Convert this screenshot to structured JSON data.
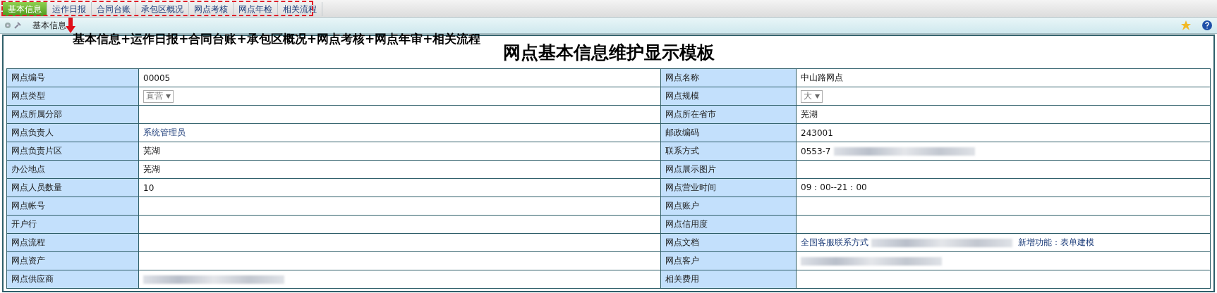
{
  "tabs": [
    {
      "label": "基本信息",
      "selected": true
    },
    {
      "label": "运作日报",
      "selected": false
    },
    {
      "label": "合同台账",
      "selected": false
    },
    {
      "label": "承包区概况",
      "selected": false
    },
    {
      "label": "网点考核",
      "selected": false
    },
    {
      "label": "网点年检",
      "selected": false
    },
    {
      "label": "相关流程",
      "selected": false
    }
  ],
  "breadcrumb": "基本信息",
  "annotation": "基本信息+运作日报+合同台账+承包区概况+网点考核+网点年审+相关流程",
  "title": "网点基本信息维护显示模板",
  "rows": [
    {
      "left": {
        "label": "网点编号",
        "value": [
          {
            "kind": "text",
            "text": "00005"
          }
        ]
      },
      "right": {
        "label": "网点名称",
        "value": [
          {
            "kind": "text",
            "text": "中山路网点"
          }
        ]
      }
    },
    {
      "left": {
        "label": "网点类型",
        "value": [
          {
            "kind": "select",
            "text": "直营"
          }
        ]
      },
      "right": {
        "label": "网点规模",
        "value": [
          {
            "kind": "select",
            "text": "大"
          }
        ]
      }
    },
    {
      "left": {
        "label": "网点所属分部"
      },
      "right": {
        "label": "网点所在省市",
        "value": [
          {
            "kind": "text",
            "text": "芜湖"
          }
        ]
      }
    },
    {
      "left": {
        "label": "网点负责人",
        "value": [
          {
            "kind": "link",
            "text": "系统管理员"
          }
        ]
      },
      "right": {
        "label": "邮政编码",
        "value": [
          {
            "kind": "text",
            "text": "243001"
          }
        ]
      }
    },
    {
      "left": {
        "label": "网点负责片区",
        "value": [
          {
            "kind": "text",
            "text": "芜湖"
          }
        ]
      },
      "right": {
        "label": "联系方式",
        "value": [
          {
            "kind": "text",
            "text": "0553-7"
          },
          {
            "kind": "redacted"
          }
        ]
      }
    },
    {
      "left": {
        "label": "办公地点",
        "value": [
          {
            "kind": "text",
            "text": "芜湖"
          }
        ]
      },
      "right": {
        "label": "网点展示图片"
      }
    },
    {
      "left": {
        "label": "网点人员数量",
        "value": [
          {
            "kind": "text",
            "text": "10"
          }
        ]
      },
      "right": {
        "label": "网点营业时间",
        "value": [
          {
            "kind": "text",
            "text": "09：00--21：00"
          }
        ]
      }
    },
    {
      "left": {
        "label": "网点帐号"
      },
      "right": {
        "label": "网点账户"
      }
    },
    {
      "left": {
        "label": "开户行"
      },
      "right": {
        "label": "网点信用度"
      }
    },
    {
      "left": {
        "label": "网点流程"
      },
      "right": {
        "label": "网点文档",
        "value": [
          {
            "kind": "link",
            "text": "全国客服联系方式"
          },
          {
            "kind": "redacted"
          },
          {
            "kind": "link",
            "text": "新增功能：表单建模"
          }
        ]
      }
    },
    {
      "left": {
        "label": "网点资产"
      },
      "right": {
        "label": "网点客户",
        "value": [
          {
            "kind": "redacted"
          }
        ]
      }
    },
    {
      "left": {
        "label": "网点供应商",
        "value": [
          {
            "kind": "redacted"
          }
        ]
      },
      "right": {
        "label": "相关费用"
      }
    }
  ]
}
